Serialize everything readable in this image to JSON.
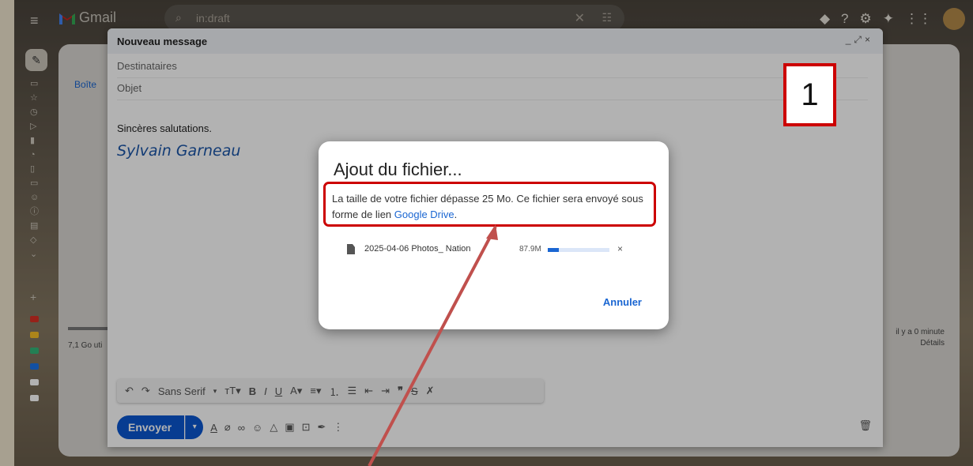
{
  "app": {
    "name": "Gmail",
    "search_value": "in:draft"
  },
  "left_rail": {
    "storage": "7,1 Go uti",
    "inbox_tab_fragment": "Boîte",
    "label_colors": [
      "#d93025",
      "#f6bf26",
      "#33b679",
      "#1a73e8",
      "#ffffff",
      "#ffffff"
    ]
  },
  "activity": {
    "line1": "il y a 0 minute",
    "line2": "Détails"
  },
  "compose": {
    "title": "Nouveau message",
    "recipients_placeholder": "Destinataires",
    "subject_placeholder": "Objet",
    "body": "Sincères salutations.",
    "signature": "Sylvain Garneau",
    "format_font": "Sans Serif",
    "send_label": "Envoyer"
  },
  "dialog": {
    "title": "Ajout du fichier...",
    "message": "La taille de votre fichier dépasse 25 Mo. Ce fichier sera envoyé sous forme de lien ",
    "link_text": "Google Drive",
    "message_end": ".",
    "file_name": "2025-04-06 Photos_ Nation",
    "file_size": "87.9M",
    "progress": 0.18,
    "cancel_label": "Annuler"
  },
  "annotation": {
    "step_number": "1",
    "color": "#cc0000"
  }
}
